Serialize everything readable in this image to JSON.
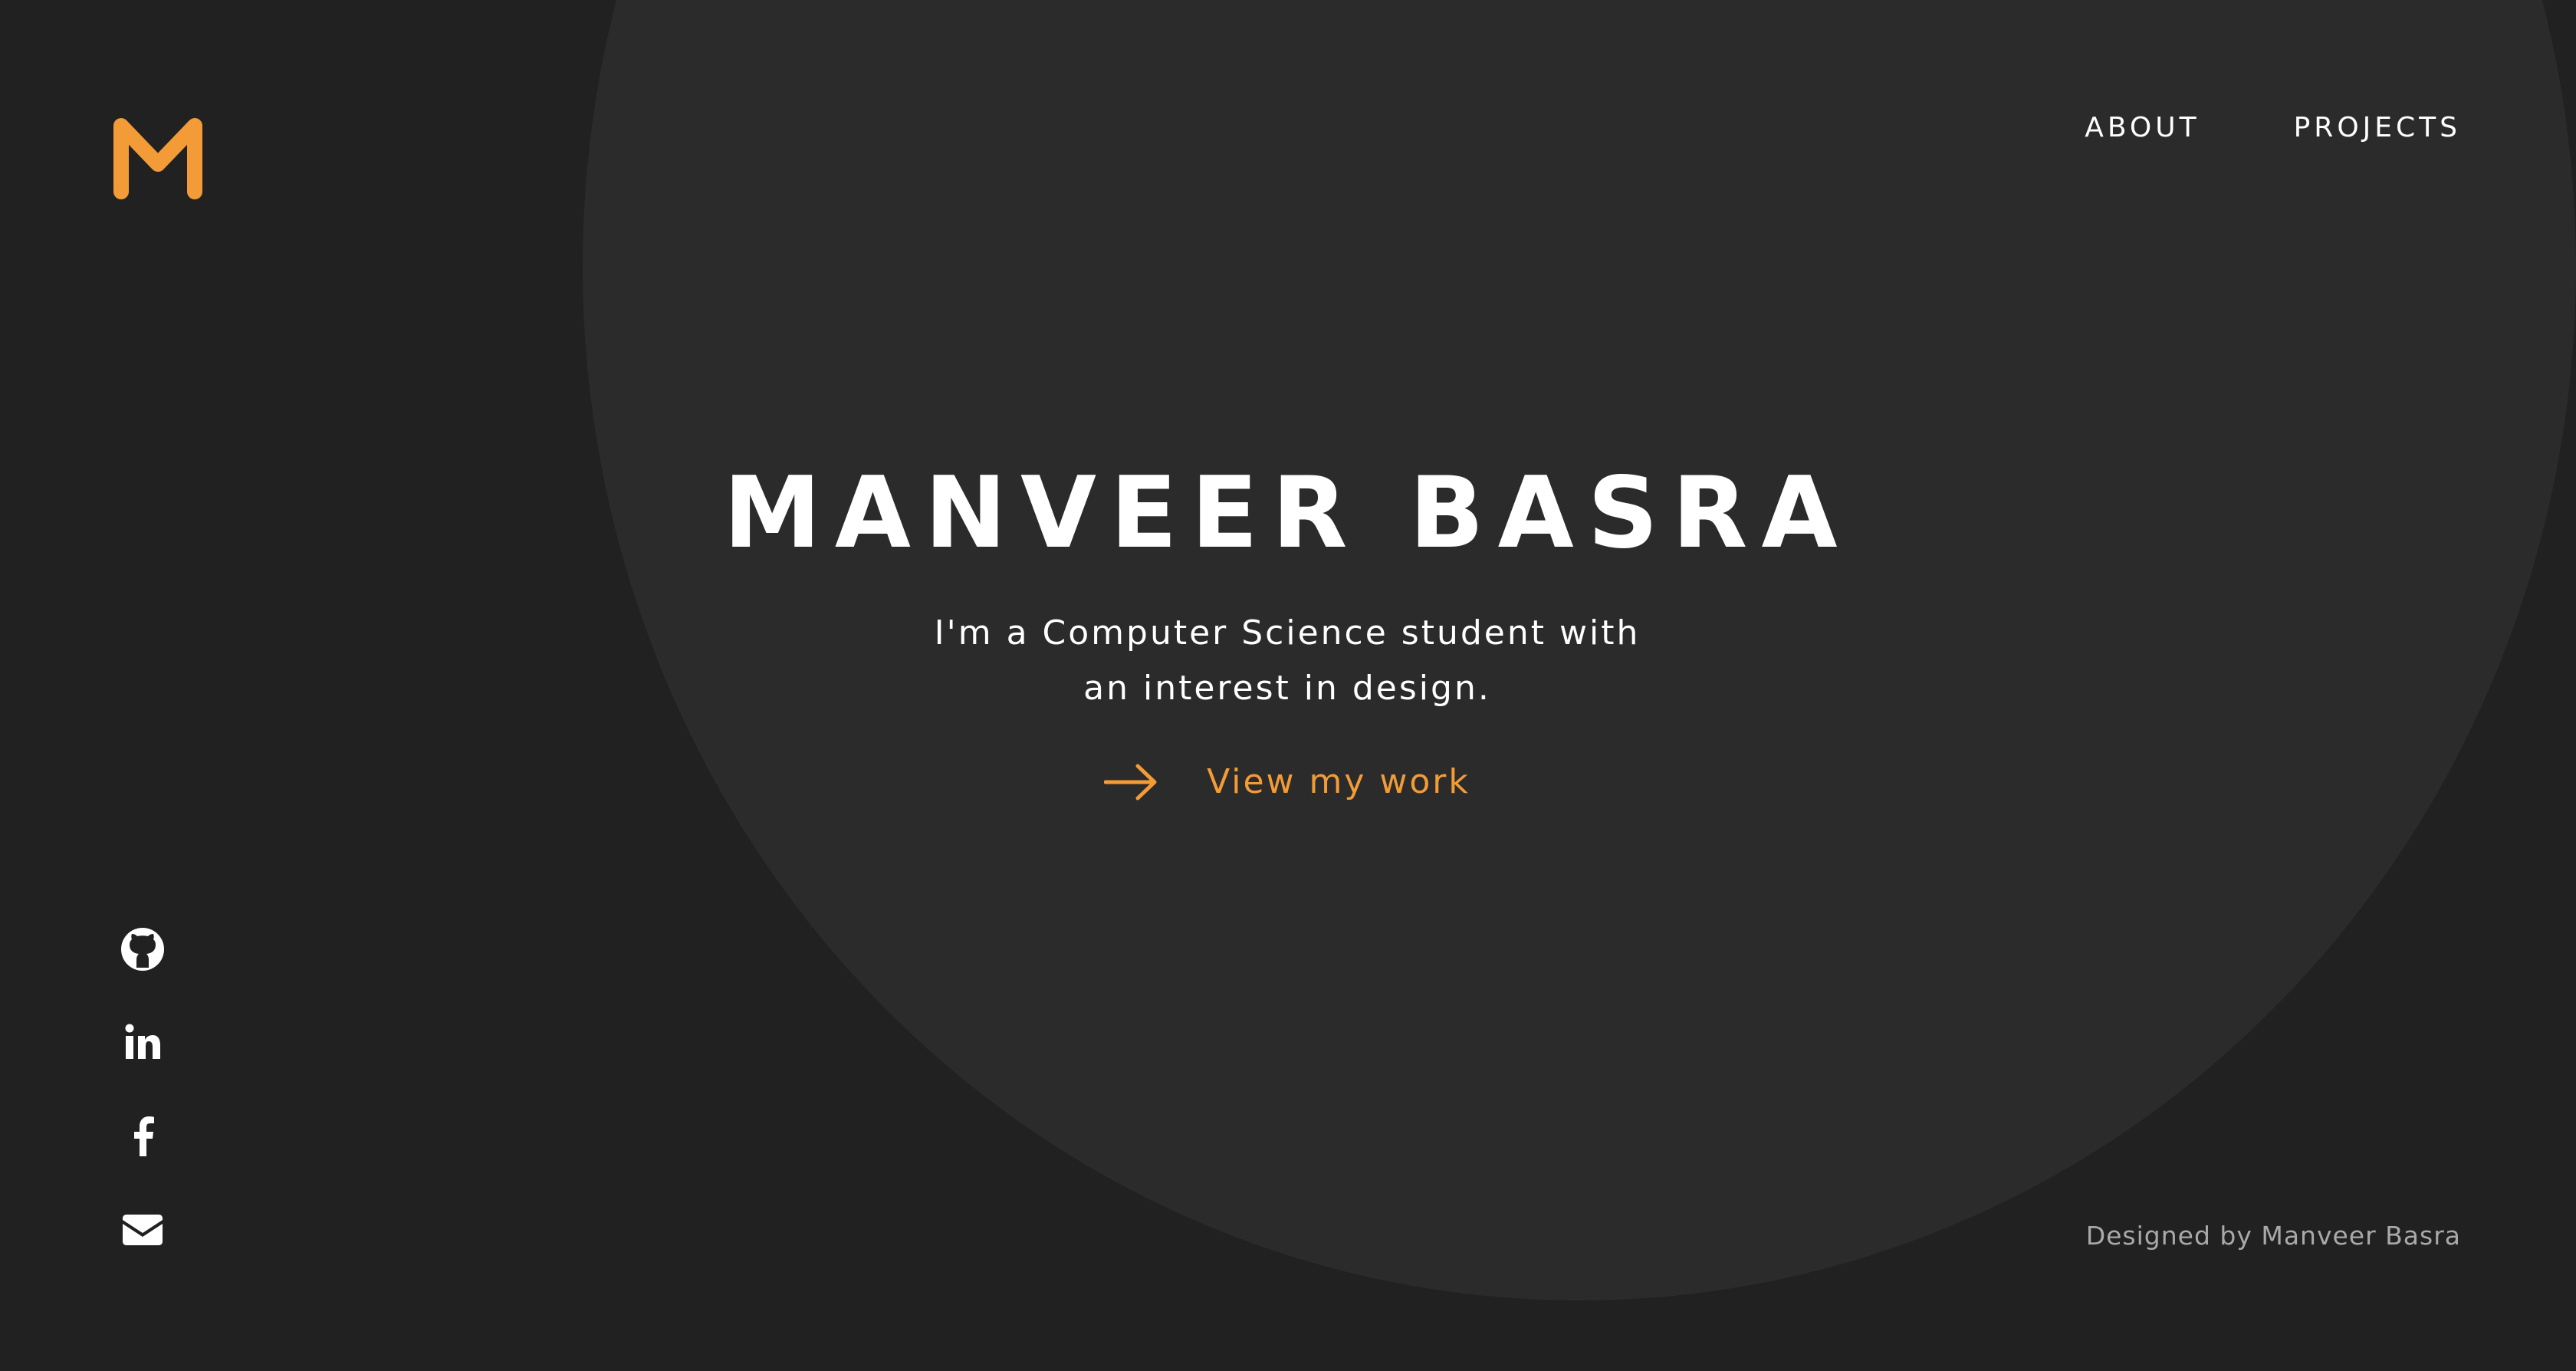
{
  "brand": {
    "logo_icon": "m-logo-icon",
    "accent_color": "#f39c37"
  },
  "nav": {
    "items": [
      {
        "label": "ABOUT"
      },
      {
        "label": "PROJECTS"
      }
    ]
  },
  "hero": {
    "title": "MANVEER BASRA",
    "subtitle": "I'm a Computer Science student with an interest in design.",
    "cta_label": "View my work",
    "cta_icon": "arrow-right-icon"
  },
  "social": {
    "icons": [
      "github-icon",
      "linkedin-icon",
      "facebook-icon",
      "email-icon"
    ]
  },
  "footer": {
    "credit": "Designed by Manveer Basra"
  },
  "colors": {
    "background": "#212121",
    "circle": "#2b2b2b",
    "text": "#ffffff",
    "muted_text": "#a9a9a9"
  }
}
